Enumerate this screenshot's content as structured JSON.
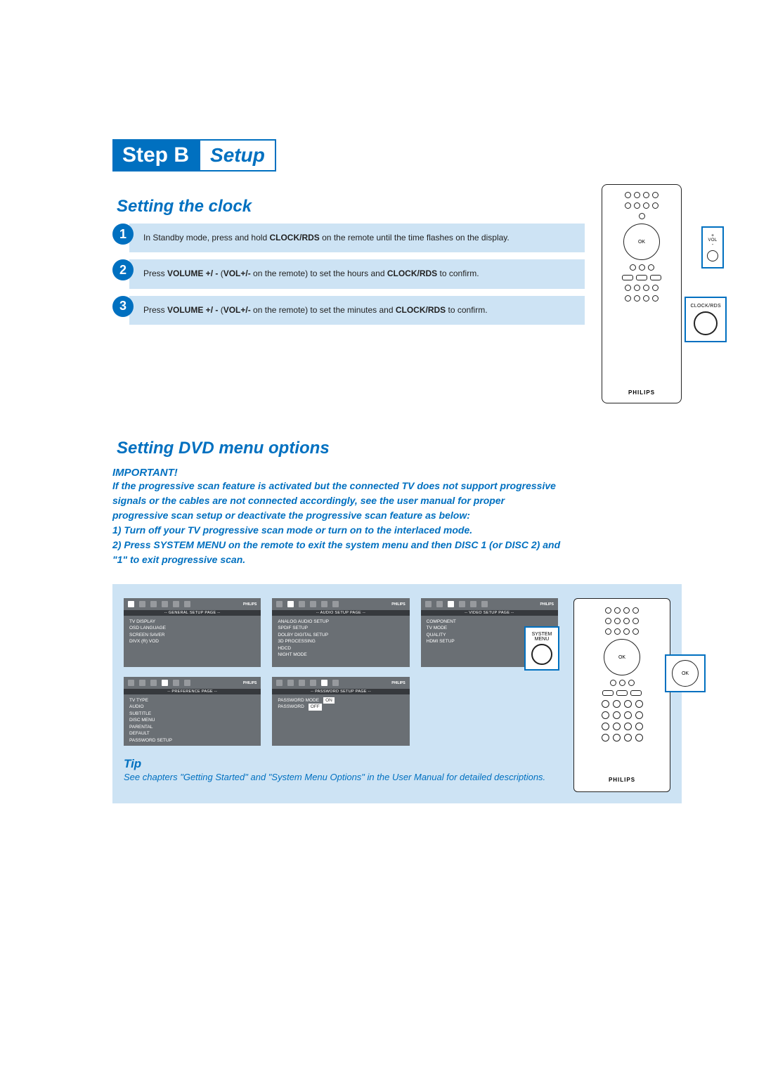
{
  "header": {
    "step_label": "Step B",
    "setup_label": "Setup"
  },
  "section1": {
    "title": "Setting the clock",
    "steps": [
      {
        "num": "1",
        "pre": "In Standby mode, press and hold ",
        "b1": "CLOCK/RDS",
        "post": " on the remote until the time flashes on the display."
      },
      {
        "num": "2",
        "pre": "Press ",
        "b1": "VOLUME +/ -",
        "mid1": " (",
        "b2": "VOL+/-",
        "mid2": " on the remote) to set the hours and ",
        "b3": "CLOCK/RDS",
        "post": " to confirm."
      },
      {
        "num": "3",
        "pre": "Press ",
        "b1": "VOLUME +/ -",
        "mid1": "  (",
        "b2": "VOL+/-",
        "mid2": " on the remote) to set the minutes and ",
        "b3": "CLOCK/RDS",
        "post": " to confirm."
      }
    ],
    "callout1": {
      "label": "VOL",
      "plus": "+",
      "minus": "-"
    },
    "callout2": {
      "label": "CLOCK/RDS"
    },
    "remote_brand": "PHILIPS",
    "ok_label": "OK"
  },
  "section2": {
    "title": "Setting DVD menu options",
    "important_label": "IMPORTANT!",
    "important_text": "If the progressive scan feature is activated but the connected TV does not support progressive signals or the cables are not connected accordingly, see the user manual for proper progressive scan setup or deactivate the progressive scan feature as below:\n1) Turn off your TV progressive scan mode or turn on to the interlaced mode.\n2) Press SYSTEM MENU on the remote to exit the system menu and then DISC 1 (or DISC 2) and \"1\" to exit progressive scan.",
    "menus": [
      {
        "title": "GENERAL SETUP PAGE",
        "items": [
          "TV DISPLAY",
          "OSD LANGUAGE",
          "SCREEN SAVER",
          "DIVX (R) VOD"
        ]
      },
      {
        "title": "AUDIO SETUP PAGE",
        "items": [
          "ANALOG AUDIO SETUP",
          "SPDIF SETUP",
          "DOLBY DIGITAL SETUP",
          "3D PROCESSING",
          "HDCD",
          "NIGHT MODE"
        ]
      },
      {
        "title": "VIDEO SETUP PAGE",
        "items": [
          "COMPONENT",
          "TV MODE",
          "QUALITY",
          "HDMI SETUP"
        ]
      },
      {
        "title": "PREFERENCE PAGE",
        "items": [
          "TV TYPE",
          "AUDIO",
          "SUBTITLE",
          "DISC MENU",
          "PARENTAL",
          "DEFAULT",
          "PASSWORD SETUP"
        ]
      },
      {
        "title": "PASSWORD SETUP PAGE",
        "items_kv": [
          {
            "k": "PASSWORD MODE",
            "v": "ON"
          },
          {
            "k": "PASSWORD",
            "v": "OFF"
          }
        ]
      }
    ],
    "menu_brand": "PHILIPS",
    "remote_callouts": {
      "system_menu": "SYSTEM\nMENU",
      "ok": "OK"
    },
    "tip_label": "Tip",
    "tip_text": "See chapters \"Getting Started\" and \"System Menu Options\" in the User Manual for detailed descriptions."
  }
}
